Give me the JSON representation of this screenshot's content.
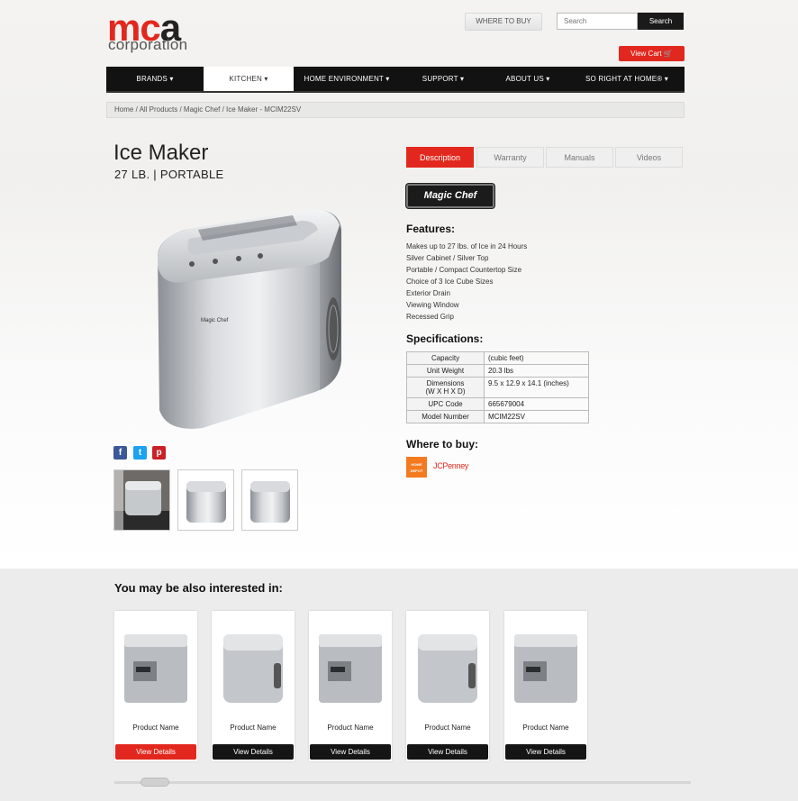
{
  "header": {
    "logo_main_red": "mc",
    "logo_main_dark": "a",
    "logo_sub": "corporation",
    "where_to_buy": "WHERE TO BUY",
    "search_placeholder": "Search",
    "search_button": "Search",
    "cart_button": "View Cart"
  },
  "nav": {
    "items": [
      {
        "label": "BRANDS ▾",
        "active": false
      },
      {
        "label": "KITCHEN ▾",
        "active": true
      },
      {
        "label": "HOME ENVIRONMENT ▾",
        "active": false
      },
      {
        "label": "SUPPORT ▾",
        "active": false
      },
      {
        "label": "ABOUT US ▾",
        "active": false
      },
      {
        "label": "SO RIGHT AT HOME® ▾",
        "active": false
      }
    ]
  },
  "breadcrumb": "Home / All Products / Magic Chef / Ice Maker - MCIM22SV",
  "product": {
    "title": "Ice Maker",
    "subtitle": "27 LB. | PORTABLE",
    "brand_badge": "Magic Chef",
    "image_brand": "Magic Chef",
    "share": {
      "facebook": "f",
      "twitter": "t",
      "pinterest": "p"
    }
  },
  "tabs": [
    "Description",
    "Warranty",
    "Manuals",
    "Videos"
  ],
  "features": {
    "heading": "Features:",
    "items": [
      "Makes up to 27 lbs. of Ice in 24 Hours",
      "Silver Cabinet / Silver Top",
      "Portable / Compact Countertop Size",
      "Choice of 3 Ice Cube Sizes",
      "Exterior Drain",
      "Viewing Window",
      "Recessed Grip"
    ]
  },
  "specs": {
    "heading": "Specifications:",
    "rows": [
      {
        "key": "Capacity",
        "key2": "",
        "value": "(cubic feet)"
      },
      {
        "key": "Unit Weight",
        "key2": "",
        "value": "20.3 lbs"
      },
      {
        "key": "Dimensions",
        "key2": "(W X H X D)",
        "value": "9.5 x 12.9 x 14.1 (inches)"
      },
      {
        "key": "UPC Code",
        "key2": "",
        "value": "665679004"
      },
      {
        "key": "Model Number",
        "key2": "",
        "value": "MCIM22SV"
      }
    ]
  },
  "where_to_buy": {
    "heading": "Where to buy:",
    "retailer_1": "HOME DEPOT",
    "retailer_2": "JCPenney"
  },
  "related": {
    "heading": "You may be also interested in:",
    "cards": [
      {
        "name": "Product Name",
        "button": "View Details",
        "highlight": true
      },
      {
        "name": "Product Name",
        "button": "View Details",
        "highlight": false
      },
      {
        "name": "Product Name",
        "button": "View Details",
        "highlight": false
      },
      {
        "name": "Product Name",
        "button": "View Details",
        "highlight": false
      },
      {
        "name": "Product Name",
        "button": "View Details",
        "highlight": false
      }
    ]
  },
  "colors": {
    "accent": "#e2281e",
    "nav": "#121212",
    "related_bg": "#ececec"
  }
}
